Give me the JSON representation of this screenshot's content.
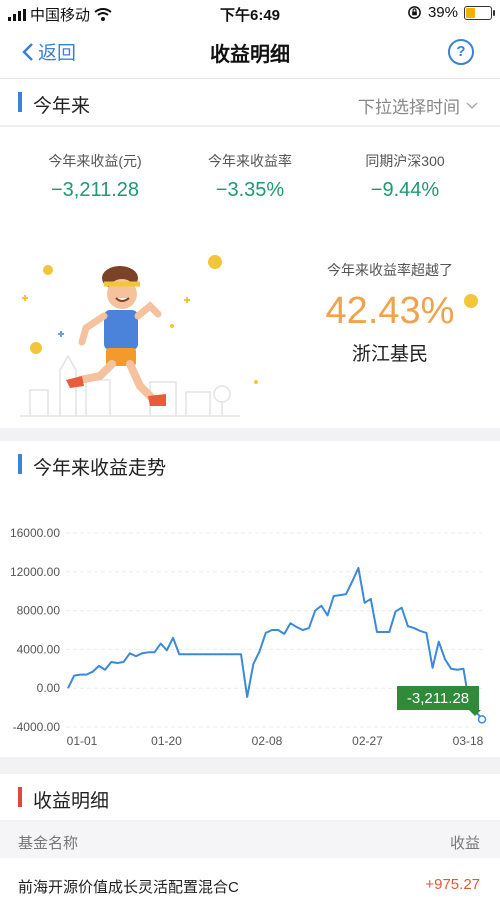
{
  "status_bar": {
    "carrier": "中国移动",
    "time": "下午6:49",
    "battery": "39%",
    "battery_level": 0.39
  },
  "nav": {
    "back_label": "返回",
    "title": "收益明细",
    "help": "?"
  },
  "period": {
    "title": "今年来",
    "select_label": "下拉选择时间"
  },
  "stats": [
    {
      "label": "今年来收益(元)",
      "value": "−3,211.28"
    },
    {
      "label": "今年来收益率",
      "value": "−3.35%"
    },
    {
      "label": "同期沪深300",
      "value": "−9.44%"
    }
  ],
  "beat": {
    "label": "今年来收益率超越了",
    "percent": "42.43%",
    "region": "浙江基民"
  },
  "trend": {
    "title": "今年来收益走势"
  },
  "chart_data": {
    "type": "line",
    "x_ticks": [
      "01-01",
      "01-20",
      "02-08",
      "02-27",
      "03-18"
    ],
    "y_ticks": [
      "16000.00",
      "12000.00",
      "8000.00",
      "4000.00",
      "0.00",
      "-4000.00"
    ],
    "ylim": [
      -4000,
      16000
    ],
    "end_label": "-3,211.28",
    "line_color": "#3b8ad9",
    "values": [
      0,
      1300,
      1400,
      1400,
      1700,
      2300,
      1900,
      2700,
      2600,
      2700,
      3600,
      3300,
      3600,
      3700,
      3700,
      4600,
      3900,
      5200,
      3500,
      3500,
      3500,
      3500,
      3500,
      3500,
      3500,
      3500,
      3500,
      3500,
      3500,
      -900,
      2500,
      3800,
      5700,
      6000,
      6000,
      5600,
      6700,
      6300,
      6000,
      6200,
      8000,
      8500,
      7500,
      9500,
      9600,
      9700,
      11000,
      12400,
      8800,
      9200,
      5800,
      5800,
      5800,
      7900,
      8300,
      6400,
      6200,
      5900,
      5700,
      2100,
      4800,
      3000,
      2000,
      1900,
      2000,
      -1800,
      -2400,
      -3211
    ]
  },
  "details": {
    "title": "收益明细",
    "col_name": "基金名称",
    "col_gain": "收益",
    "rows": [
      {
        "name": "前海开源价值成长灵活配置混合C",
        "gain": "+975.27"
      }
    ]
  }
}
